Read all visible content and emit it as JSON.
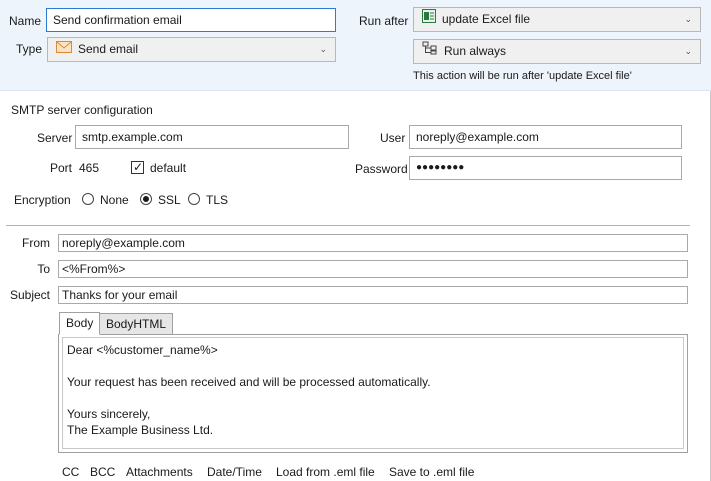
{
  "header": {
    "name_label": "Name",
    "name_value": "Send confirmation email",
    "type_label": "Type",
    "type_value": "Send email",
    "run_after_label": "Run after",
    "run_after_value": "update Excel file",
    "run_condition_value": "Run always",
    "run_note": "This action will be run after 'update Excel file'"
  },
  "smtp": {
    "section_title": "SMTP server configuration",
    "server_label": "Server",
    "server_value": "smtp.example.com",
    "user_label": "User",
    "user_value": "noreply@example.com",
    "port_label": "Port",
    "port_value": "465",
    "default_label": "default",
    "default_checked": true,
    "password_label": "Password",
    "password_value": "●●●●●●●●",
    "encryption_label": "Encryption",
    "encryption_options": [
      "None",
      "SSL",
      "TLS"
    ],
    "encryption_selected": "SSL"
  },
  "email": {
    "from_label": "From",
    "from_value": "noreply@example.com",
    "to_label": "To",
    "to_value": "<%From%>",
    "subject_label": "Subject",
    "subject_value": "Thanks for your email",
    "tabs": [
      "Body",
      "BodyHTML"
    ],
    "active_tab": "Body",
    "body_text": "Dear <%customer_name%>\n\nYour request has been received and will be processed automatically.\n\nYours sincerely,\nThe Example Business Ltd."
  },
  "footer_links": [
    "CC",
    "BCC",
    "Attachments",
    "Date/Time",
    "Load from .eml file",
    "Save to .eml file"
  ],
  "icons": {
    "type": "envelope-icon",
    "run_after": "excel-icon",
    "run_condition": "flow-icon"
  },
  "colors": {
    "panel_bg": "#eef4fb",
    "focus_border": "#2a7bd4"
  }
}
